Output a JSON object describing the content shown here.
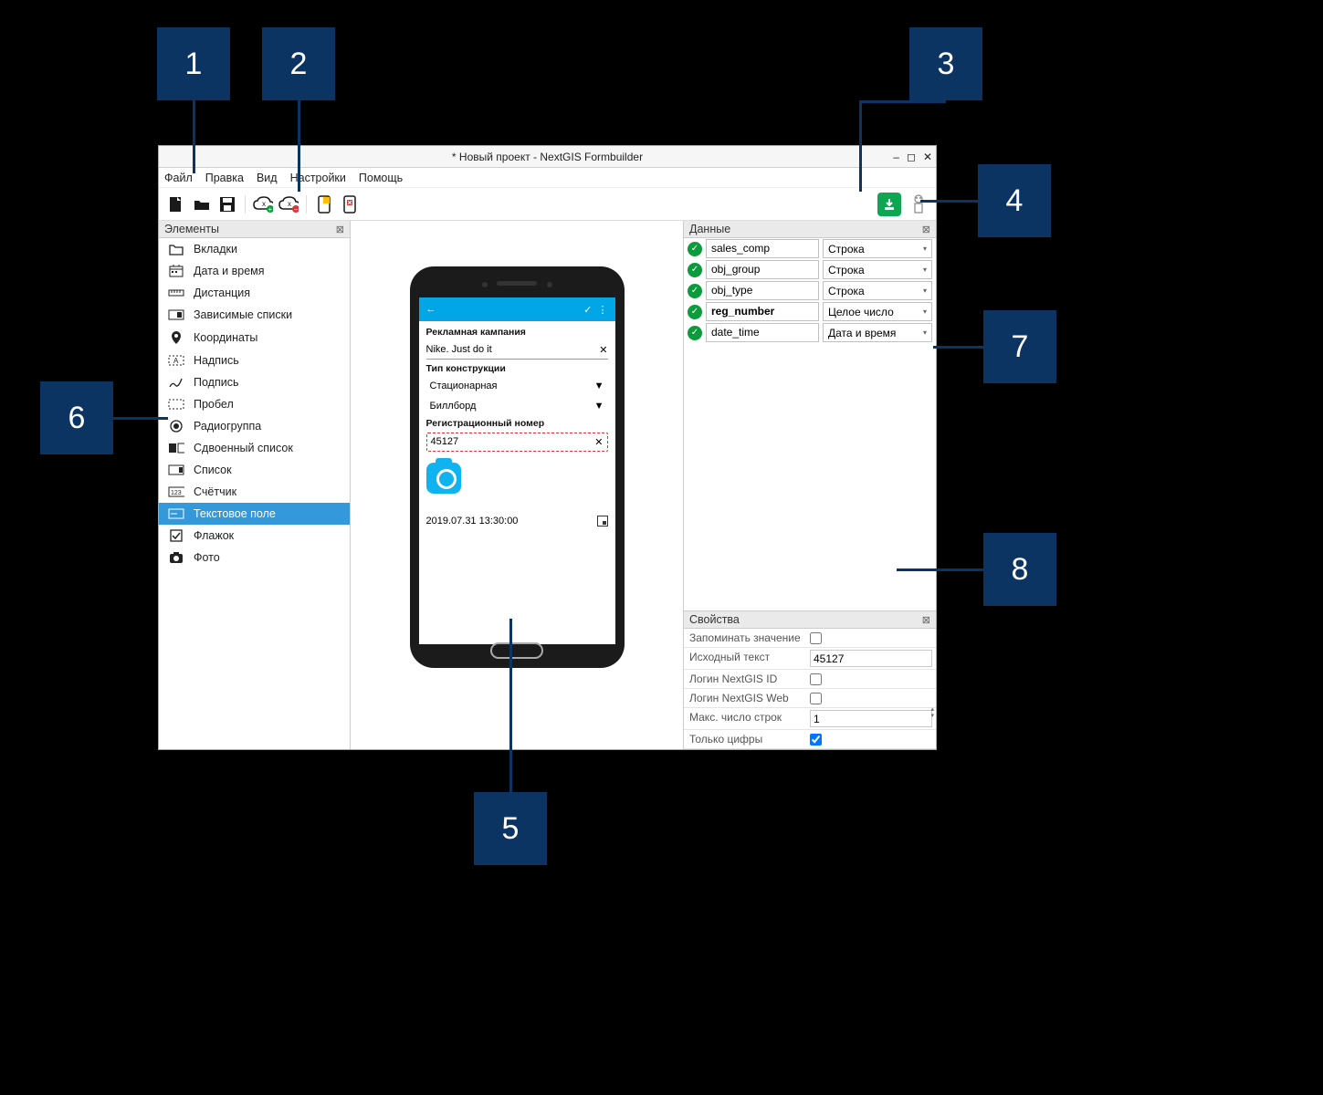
{
  "callouts": {
    "c1": "1",
    "c2": "2",
    "c3": "3",
    "c4": "4",
    "c5": "5",
    "c6": "6",
    "c7": "7",
    "c8": "8"
  },
  "window": {
    "title": "* Новый проект - NextGIS Formbuilder"
  },
  "menu": {
    "file": "Файл",
    "edit": "Правка",
    "view": "Вид",
    "settings": "Настройки",
    "help": "Помощь"
  },
  "panels": {
    "elements": "Элементы",
    "data": "Данные",
    "props": "Свойства"
  },
  "elements": [
    {
      "icon": "folder",
      "label": "Вкладки",
      "selected": false
    },
    {
      "icon": "calendar",
      "label": "Дата и время",
      "selected": false
    },
    {
      "icon": "ruler",
      "label": "Дистанция",
      "selected": false
    },
    {
      "icon": "deplist",
      "label": "Зависимые списки",
      "selected": false
    },
    {
      "icon": "pin",
      "label": "Координаты",
      "selected": false
    },
    {
      "icon": "label",
      "label": "Надпись",
      "selected": false
    },
    {
      "icon": "sign",
      "label": "Подпись",
      "selected": false
    },
    {
      "icon": "space",
      "label": "Пробел",
      "selected": false
    },
    {
      "icon": "radio",
      "label": "Радиогруппа",
      "selected": false
    },
    {
      "icon": "duallist",
      "label": "Сдвоенный список",
      "selected": false
    },
    {
      "icon": "list",
      "label": "Список",
      "selected": false
    },
    {
      "icon": "counter",
      "label": "Счётчик",
      "selected": false
    },
    {
      "icon": "text",
      "label": "Текстовое поле",
      "selected": true
    },
    {
      "icon": "check",
      "label": "Флажок",
      "selected": false
    },
    {
      "icon": "photo",
      "label": "Фото",
      "selected": false
    }
  ],
  "phone": {
    "section1": "Рекламная кампания",
    "input1": "Nike. Just do it",
    "section2": "Тип конструкции",
    "select1": "Стационарная",
    "select2": "Биллборд",
    "section3": "Регистрационный номер",
    "input3": "45127",
    "datetime": "2019.07.31 13:30:00"
  },
  "data_rows": [
    {
      "name": "sales_comp",
      "type": "Строка",
      "bold": false
    },
    {
      "name": "obj_group",
      "type": "Строка",
      "bold": false
    },
    {
      "name": "obj_type",
      "type": "Строка",
      "bold": false
    },
    {
      "name": "reg_number",
      "type": "Целое число",
      "bold": true
    },
    {
      "name": "date_time",
      "type": "Дата и время",
      "bold": false
    }
  ],
  "props": {
    "remember": {
      "label": "Запоминать значение",
      "checked": false
    },
    "init_text": {
      "label": "Исходный текст",
      "value": "45127"
    },
    "login_id": {
      "label": "Логин NextGIS ID",
      "checked": false
    },
    "login_web": {
      "label": "Логин NextGIS Web",
      "checked": false
    },
    "max_lines": {
      "label": "Макс. число строк",
      "value": "1"
    },
    "digits_only": {
      "label": "Только цифры",
      "checked": true
    }
  }
}
